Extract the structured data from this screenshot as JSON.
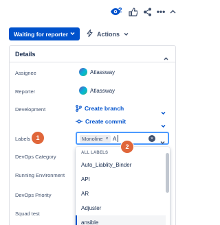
{
  "topbar": {
    "watch_icon": "eye-icon",
    "watch_count": "2",
    "like_icon": "thumbs-up-icon",
    "share_icon": "share-icon",
    "more_label": "•••",
    "collapse_icon": "chevron-up-icon"
  },
  "status": {
    "label": "Waiting for reporter"
  },
  "actions": {
    "label": "Actions",
    "icon": "lightning-icon"
  },
  "details": {
    "title": "Details",
    "fields": {
      "assignee": {
        "label": "Assignee",
        "value": "Atlassway"
      },
      "reporter": {
        "label": "Reporter",
        "value": "Atlassway"
      },
      "development": {
        "label": "Development",
        "create_branch": "Create branch",
        "create_commit": "Create commit"
      },
      "labels": {
        "label": "Labels"
      },
      "devops_category": {
        "label": "DevOps Category"
      },
      "running_environment": {
        "label": "Running Environment"
      },
      "devops_priority": {
        "label": "DevOps Priority"
      },
      "squad_test": {
        "label": "Squad test"
      }
    }
  },
  "labels_input": {
    "tag": "Monoline",
    "tag_remove": "×",
    "typed_text": "A",
    "clear": "×"
  },
  "dropdown": {
    "header": "ALL LABELS",
    "options": [
      "Auto_Liablity_Binder",
      "API",
      "AR",
      "Adjuster",
      "ansible"
    ]
  },
  "callouts": {
    "one": "1",
    "two": "2"
  },
  "colors": {
    "primary": "#0052cc",
    "callout": "#e0663a",
    "focus": "#4c9aff"
  }
}
